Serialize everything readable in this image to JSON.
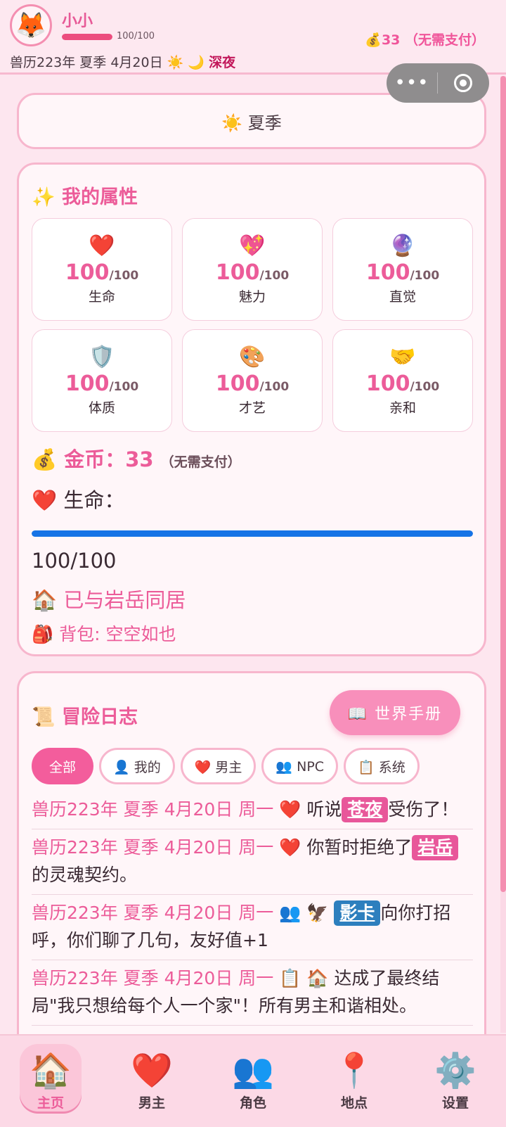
{
  "header": {
    "avatar_icon": "🦊",
    "user_name": "小小",
    "hp_text": "100/100",
    "hp_fraction": 1.0,
    "date_text": "兽历223年 夏季 4月20日",
    "weather_icons": "☀️ 🌙",
    "time_of_day": "深夜",
    "coins_text": "💰33 （无需支付）"
  },
  "mini_program_capsule": {
    "more_icon": "•••",
    "close_icon": "target-icon"
  },
  "season_card": {
    "label": "☀️ 夏季"
  },
  "attributes": {
    "title": "✨ 我的属性",
    "stats": [
      {
        "icon": "❤️",
        "value": "100",
        "max": "/100",
        "label": "生命"
      },
      {
        "icon": "💖",
        "value": "100",
        "max": "/100",
        "label": "魅力"
      },
      {
        "icon": "🔮",
        "value": "100",
        "max": "/100",
        "label": "直觉"
      },
      {
        "icon": "🛡️",
        "value": "100",
        "max": "/100",
        "label": "体质"
      },
      {
        "icon": "🎨",
        "value": "100",
        "max": "/100",
        "label": "才艺"
      },
      {
        "icon": "🤝",
        "value": "100",
        "max": "/100",
        "label": "亲和"
      }
    ],
    "coins_label": "💰 金币：33",
    "coins_note": "（无需支付）",
    "life_label": "❤️ 生命：",
    "life_fraction": 1.0,
    "life_text": "100/100",
    "cohabit_text": "🏠 已与岩岳同居",
    "bag_text": "🎒 背包: 空空如也"
  },
  "log": {
    "title": "📜 冒险日志",
    "manual_button": "📖 世界手册",
    "filters": [
      "全部",
      "👤 我的",
      "❤️ 男主",
      "👥 NPC",
      "📋 系统"
    ],
    "entries": [
      {
        "date": "兽历223年 夏季 4月20日 周一",
        "icon": "❤️",
        "pre": "听说",
        "tag": "苍夜",
        "post": "受伤了！"
      },
      {
        "date": "兽历223年 夏季 4月20日 周一",
        "icon": "❤️",
        "pre": "你暂时拒绝了",
        "tag": "岩岳",
        "post": "的灵魂契约。"
      },
      {
        "date": "兽历223年 夏季 4月20日 周一",
        "icon": "👥 🦅",
        "pre": "",
        "tag": "影卡",
        "post": "向你打招呼，你们聊了几句，友好值+1"
      },
      {
        "date": "兽历223年 夏季 4月20日 周一",
        "icon": "📋 🏠",
        "pre": "达成了最终结局\"我只想给每个人一个家\"！所有男主和谐相处。",
        "tag": "",
        "post": ""
      }
    ]
  },
  "bottom_nav": [
    {
      "icon": "🏠",
      "label": "主页",
      "active": true
    },
    {
      "icon": "❤️",
      "label": "男主",
      "active": false
    },
    {
      "icon": "👥",
      "label": "角色",
      "active": false
    },
    {
      "icon": "📍",
      "label": "地点",
      "active": false
    },
    {
      "icon": "⚙️",
      "label": "设置",
      "active": false
    }
  ],
  "colors": {
    "accent": "#ec5c99",
    "life_bar": "#1673e6",
    "tag_pink": "#e8579a",
    "tag_blue": "#2d7fbe"
  }
}
